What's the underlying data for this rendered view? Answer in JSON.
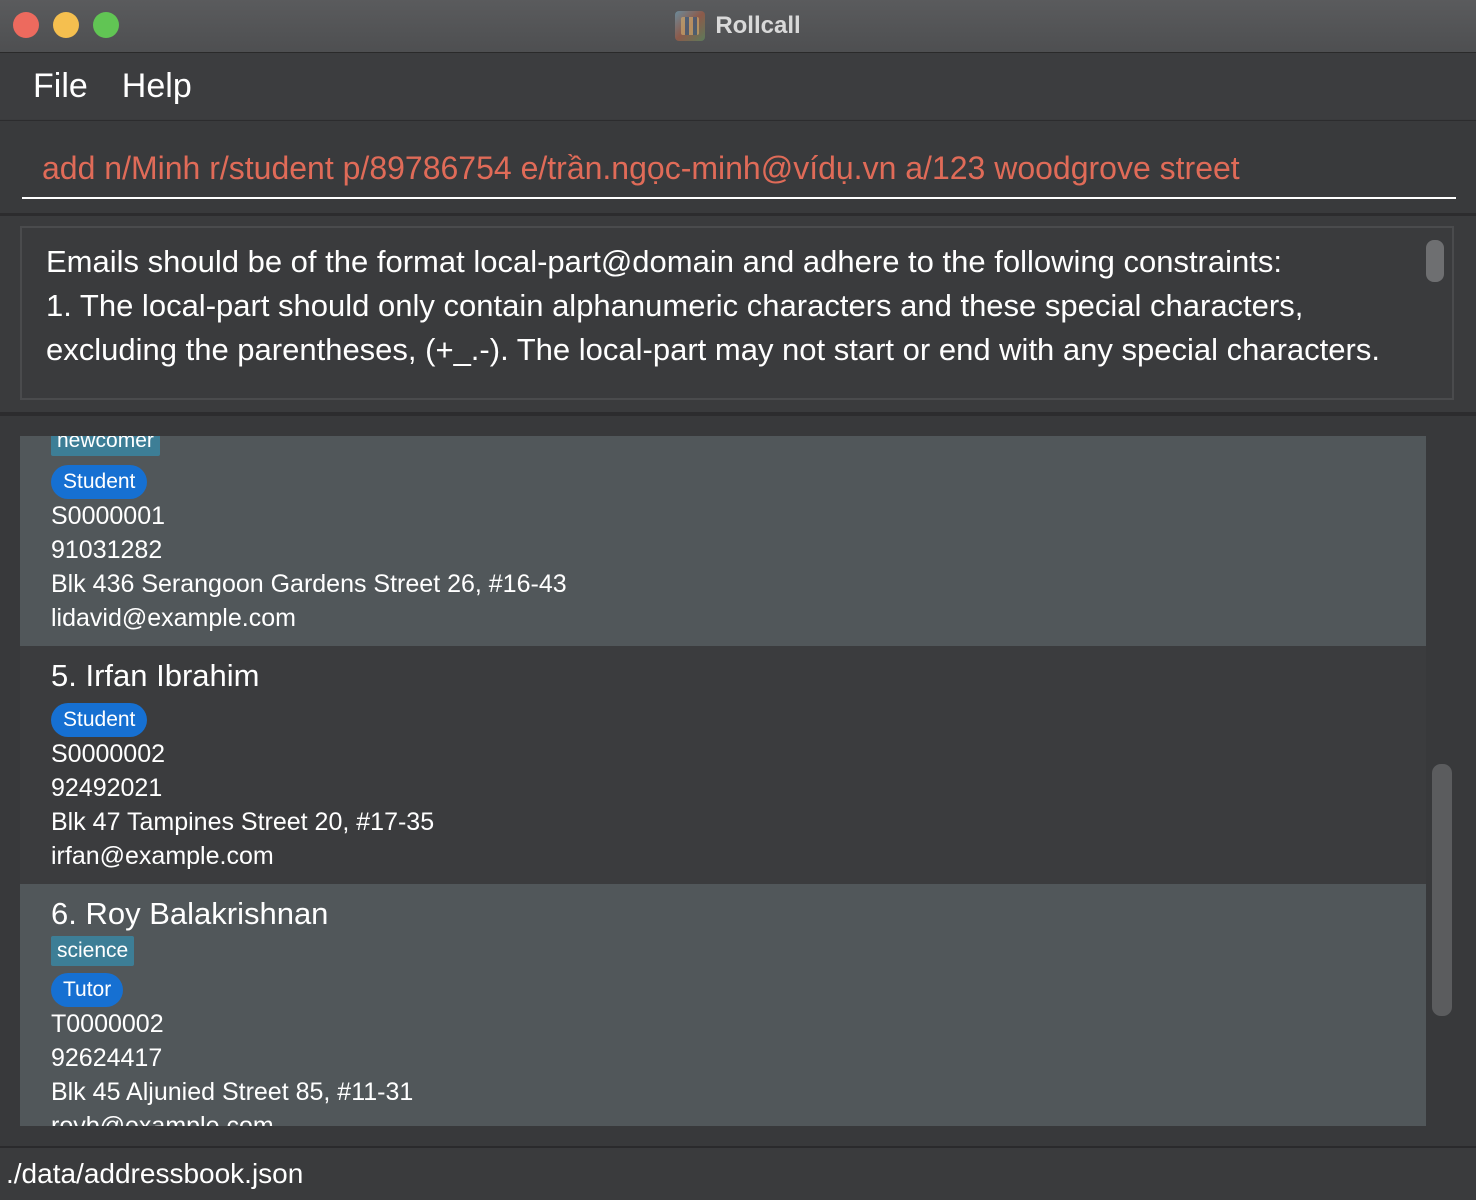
{
  "window": {
    "title": "Rollcall",
    "icon": "rollcall-app-icon"
  },
  "menu": {
    "file": "File",
    "help": "Help"
  },
  "command": {
    "value": "add n/Minh r/student p/89786754 e/trần.ngọc-minh@vídụ.vn a/123 woodgrove street"
  },
  "result": {
    "text": "Emails should be of the format local-part@domain and adhere to the following constraints:\n1. The local-part should only contain alphanumeric characters and these special characters, excluding the parentheses, (+_.-). The local-part may not start or end with any special characters."
  },
  "people": [
    {
      "tag": "newcomer",
      "role": "Student",
      "id": "S0000001",
      "phone": "91031282",
      "address": "Blk 436 Serangoon Gardens Street 26, #16-43",
      "email": "lidavid@example.com"
    },
    {
      "name": "5. Irfan Ibrahim",
      "role": "Student",
      "id": "S0000002",
      "phone": "92492021",
      "address": "Blk 47 Tampines Street 20, #17-35",
      "email": "irfan@example.com"
    },
    {
      "name": "6. Roy Balakrishnan",
      "tag": "science",
      "role": "Tutor",
      "id": "T0000002",
      "phone": "92624417",
      "address": "Blk 45 Aljunied Street 85, #11-31",
      "email": "royb@example.com"
    }
  ],
  "status": {
    "file_path": "./data/addressbook.json"
  },
  "colors": {
    "command_text": "#e06b58",
    "role_badge": "#1670d2",
    "tag_badge": "#3d7e96",
    "card_light": "#51575a",
    "card_dark": "#3b3c3e"
  }
}
